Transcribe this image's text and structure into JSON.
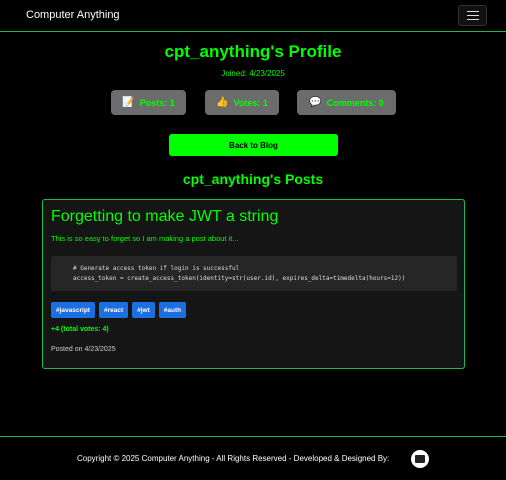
{
  "navbar": {
    "brand": "Computer Anything",
    "menu_icon": "hamburger-icon"
  },
  "profile": {
    "title": "cpt_anything's Profile",
    "joined": "Joined: 4/23/2025",
    "stats": {
      "posts": {
        "icon": "📝",
        "label": "Posts: 1"
      },
      "votes": {
        "icon": "👍",
        "label": "Votes: 1"
      },
      "comments": {
        "icon": "💬",
        "label": "Comments: 0"
      }
    },
    "back_button": "Back to Blog"
  },
  "posts_section": {
    "title": "cpt_anything's Posts"
  },
  "post": {
    "title": "Forgetting to make JWT a string",
    "excerpt": "This is so easy to forget so I am making a post about it...",
    "code_line1": "# Generate access token if login is successful",
    "code_line2": "access_token = create_access_token(identity=str(user.id), expires_delta=timedelta(hours=12))",
    "tags": [
      "#javascript",
      "#react",
      "#jwt",
      "#auth"
    ],
    "votes": "+4 (total votes: 4)",
    "posted": "Posted on 4/23/2025"
  },
  "footer": {
    "text": "Copyright © 2025 Computer Anything - All Rights Reserved - Developed & Designed By:",
    "logo_icon": "designer-logo-icon"
  },
  "colors": {
    "accent": "#00ff00",
    "border": "#1db954",
    "tag": "#1b6fe0",
    "stat_bg": "#6c6c6c"
  }
}
